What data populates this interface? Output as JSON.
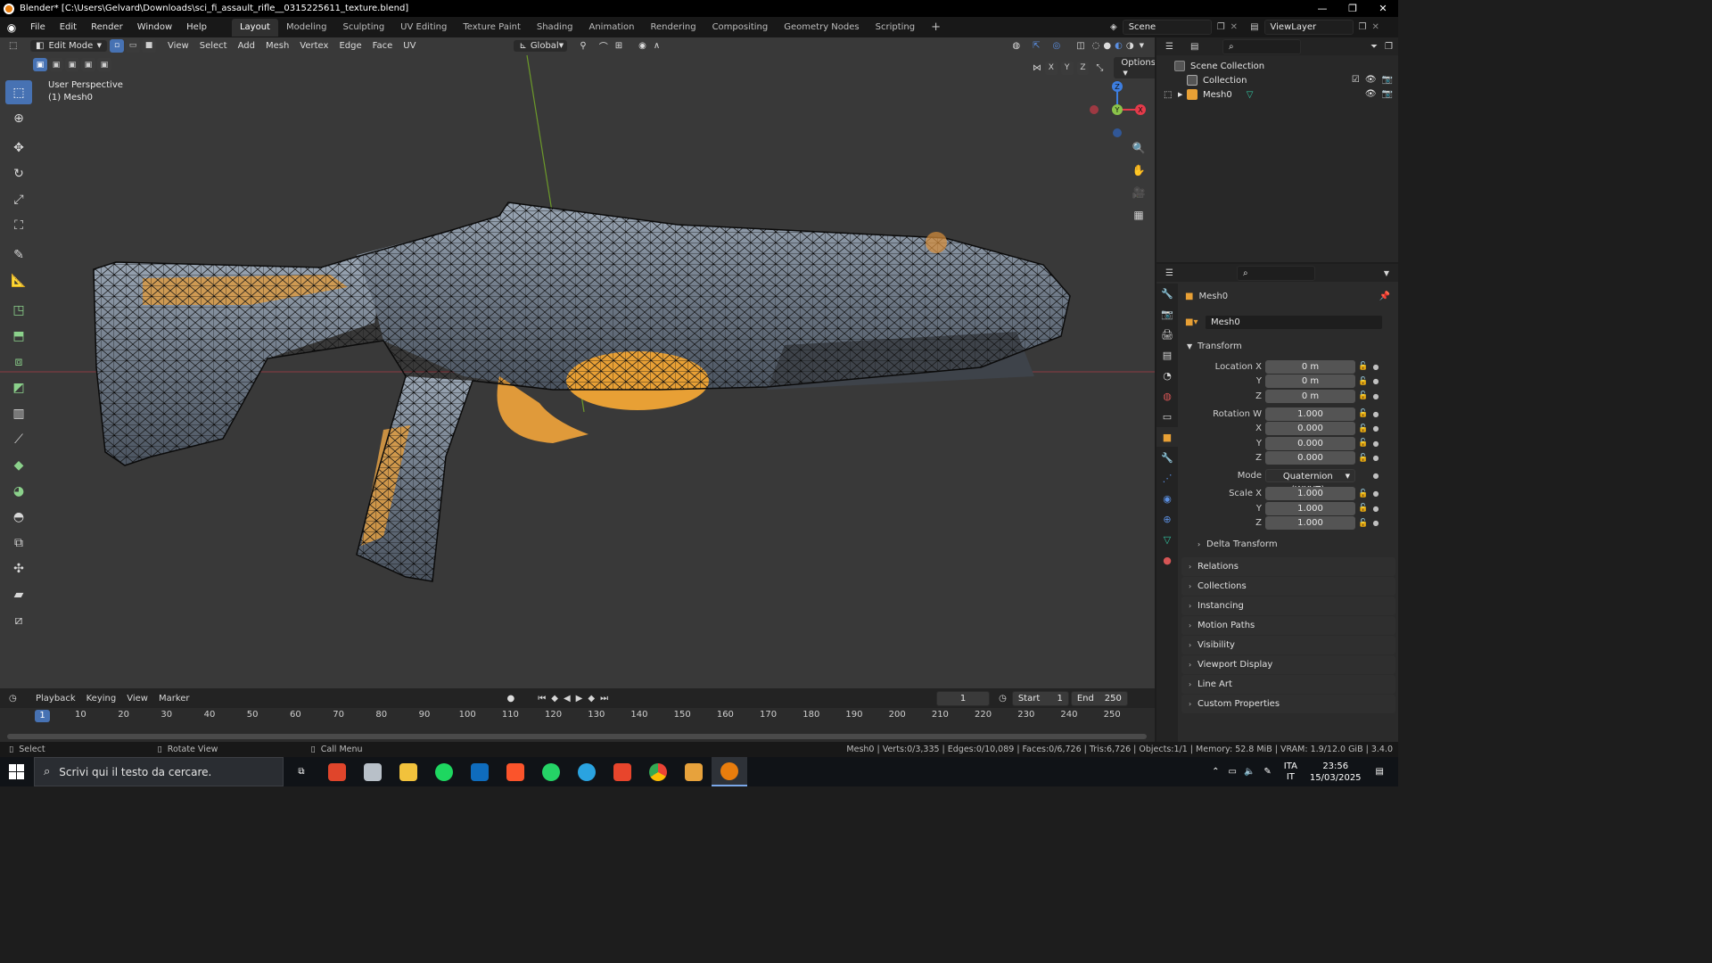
{
  "window": {
    "title": "Blender* [C:\\Users\\Gelvard\\Downloads\\sci_fi_assault_rifle__0315225611_texture.blend]",
    "controls": [
      "—",
      "❐",
      "✕"
    ]
  },
  "menubar": {
    "items": [
      "File",
      "Edit",
      "Render",
      "Window",
      "Help"
    ],
    "workspaces": [
      "Layout",
      "Modeling",
      "Sculpting",
      "UV Editing",
      "Texture Paint",
      "Shading",
      "Animation",
      "Rendering",
      "Compositing",
      "Geometry Nodes",
      "Scripting"
    ],
    "active_workspace": "Layout",
    "add_workspace": "+",
    "scene": "Scene",
    "view_layer": "ViewLayer"
  },
  "viewport": {
    "mode": "Edit Mode",
    "menus": [
      "View",
      "Select",
      "Add",
      "Mesh",
      "Vertex",
      "Edge",
      "Face",
      "UV"
    ],
    "orientation": "Global",
    "perspective_label": "User Perspective",
    "object_label": "(1) Mesh0",
    "axis_locks": [
      "X",
      "Y",
      "Z"
    ],
    "options_label": "Options",
    "gizmo_labels": {
      "z": "Z",
      "y": "Y",
      "x": "X"
    },
    "colors": {
      "background": "#393939",
      "x_axis": "#e53a4a",
      "y_axis": "#8bc34a",
      "z_axis": "#3d7ee0",
      "mesh_orange": "#e8a035",
      "mesh_steel": "#7f8b9a"
    }
  },
  "timeline": {
    "menus": [
      "Playback",
      "Keying",
      "View",
      "Marker"
    ],
    "current_frame": "1",
    "start_label": "Start",
    "start": "1",
    "end_label": "End",
    "end": "250",
    "ticks": [
      "10",
      "20",
      "30",
      "40",
      "50",
      "60",
      "70",
      "80",
      "90",
      "100",
      "110",
      "120",
      "130",
      "140",
      "150",
      "160",
      "170",
      "180",
      "190",
      "200",
      "210",
      "220",
      "230",
      "240",
      "250"
    ],
    "playhead": "1"
  },
  "statusbar": {
    "select": "Select",
    "rotate": "Rotate View",
    "call_menu": "Call Menu",
    "stats": "Mesh0 | Verts:0/3,335 | Edges:0/10,089 | Faces:0/6,726 | Tris:6,726 | Objects:1/1 | Memory: 52.8 MiB | VRAM: 1.9/12.0 GiB | 3.4.0"
  },
  "outliner": {
    "scene_collection": "Scene Collection",
    "collection": "Collection",
    "object": "Mesh0"
  },
  "properties": {
    "object_name": "Mesh0",
    "data_name": "Mesh0",
    "transform_title": "Transform",
    "location": {
      "label": "Location X",
      "x": "0 m",
      "y_label": "Y",
      "y": "0 m",
      "z_label": "Z",
      "z": "0 m"
    },
    "rotation": {
      "label": "Rotation W",
      "w": "1.000",
      "x_label": "X",
      "x": "0.000",
      "y_label": "Y",
      "y": "0.000",
      "z_label": "Z",
      "z": "0.000"
    },
    "mode_label": "Mode",
    "mode_value": "Quaternion (WXYZ)",
    "scale": {
      "label": "Scale X",
      "x": "1.000",
      "y_label": "Y",
      "y": "1.000",
      "z_label": "Z",
      "z": "1.000"
    },
    "delta_transform": "Delta Transform",
    "panels": [
      "Relations",
      "Collections",
      "Instancing",
      "Motion Paths",
      "Visibility",
      "Viewport Display",
      "Line Art",
      "Custom Properties"
    ]
  },
  "taskbar": {
    "search_placeholder": "Scrivi qui il testo da cercare.",
    "language": "ITA",
    "language_sub": "IT",
    "time": "23:56",
    "date": "15/03/2025"
  }
}
